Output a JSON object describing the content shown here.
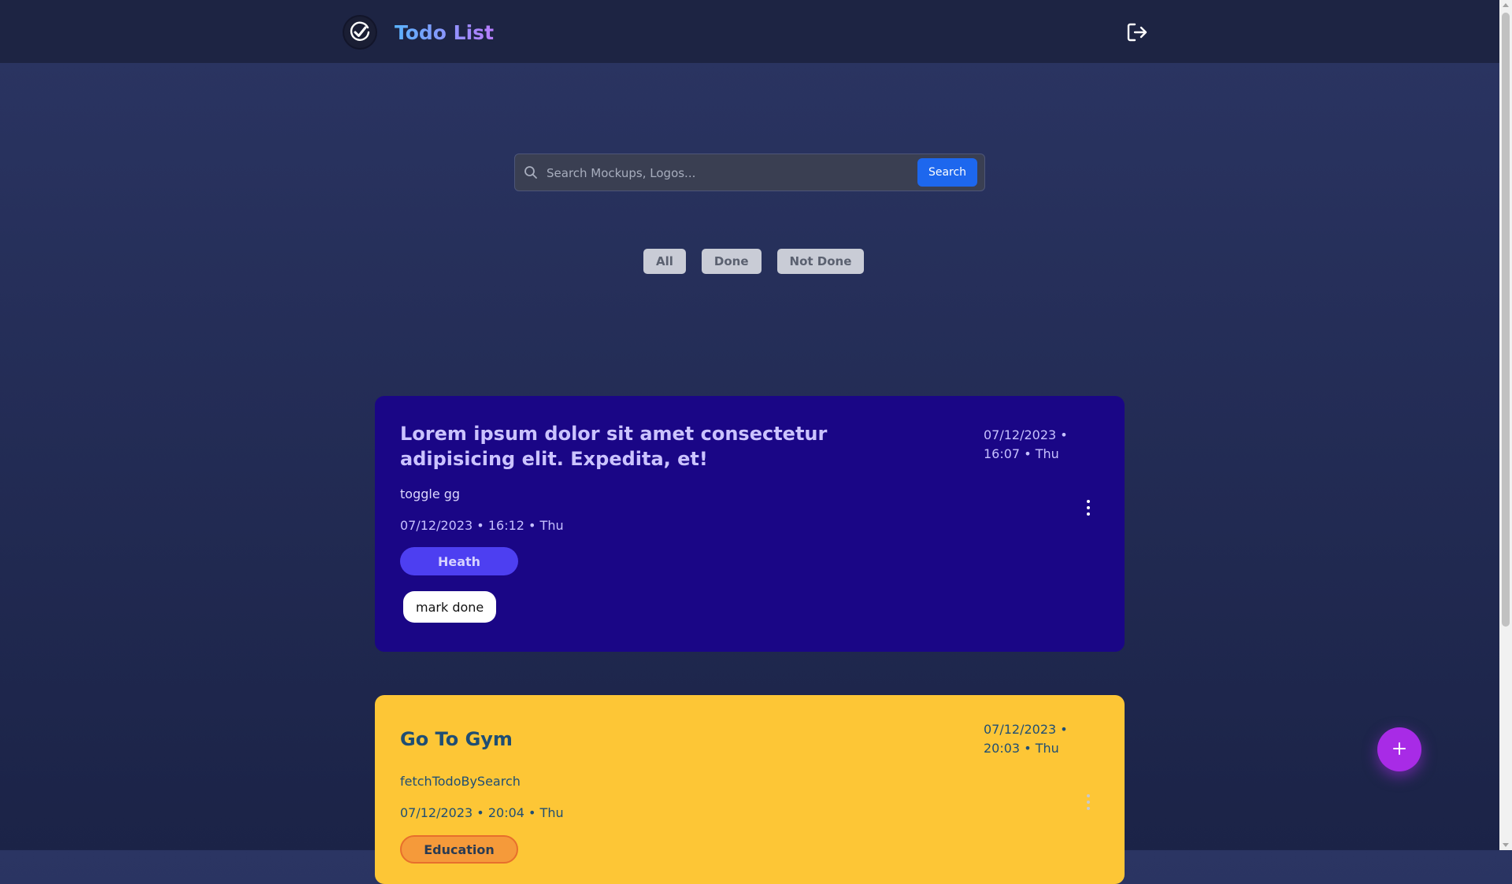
{
  "header": {
    "title": "Todo List",
    "logo_icon": "check-circle-icon",
    "logout_icon": "logout-icon"
  },
  "search": {
    "placeholder": "Search Mockups, Logos...",
    "value": "",
    "button_label": "Search",
    "icon": "search-icon"
  },
  "filters": [
    {
      "label": "All"
    },
    {
      "label": "Done"
    },
    {
      "label": "Not Done"
    }
  ],
  "todos": [
    {
      "title": "Lorem ipsum dolor sit amet consectetur adipisicing elit. Expedita, et!",
      "date": "07/12/2023 • 16:07 • Thu",
      "description": "toggle gg",
      "created": "07/12/2023 • 16:12 • Thu",
      "tag": "Heath",
      "action_label": "mark done",
      "background": "#1a0686"
    },
    {
      "title": "Go To Gym",
      "date": "07/12/2023 • 20:03 • Thu",
      "description": "fetchTodoBySearch",
      "created": "07/12/2023 • 20:04 • Thu",
      "tag": "Education",
      "background": "#fdc636"
    }
  ],
  "fab": {
    "icon": "plus-icon"
  },
  "colors": {
    "accent_blue": "#1d67ee",
    "fab_purple": "#a82be6",
    "tag_health": "#4d3ff1",
    "tag_education": "#f59a3a"
  }
}
